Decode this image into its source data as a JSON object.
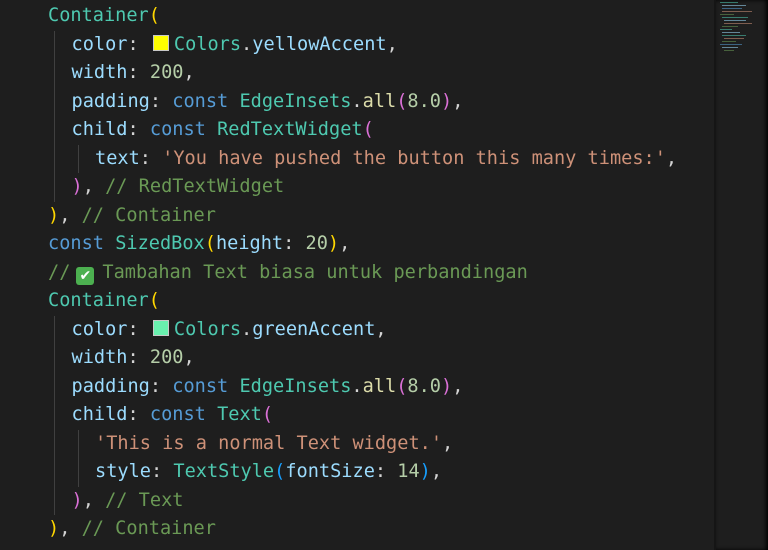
{
  "editor": {
    "lines": [
      {
        "indent": 0,
        "tokens": [
          {
            "t": "Container",
            "c": "cls"
          },
          {
            "t": "(",
            "c": "b1"
          }
        ]
      },
      {
        "indent": 1,
        "tokens": [
          {
            "t": "color",
            "c": "prop"
          },
          {
            "t": ": ",
            "c": "pun"
          },
          {
            "swatch": "#ffff00",
            "name": "yellow-accent-swatch"
          },
          {
            "t": "Colors",
            "c": "cls"
          },
          {
            "t": ".",
            "c": "pun"
          },
          {
            "t": "yellowAccent",
            "c": "prop"
          },
          {
            "t": ",",
            "c": "pun"
          }
        ]
      },
      {
        "indent": 1,
        "tokens": [
          {
            "t": "width",
            "c": "prop"
          },
          {
            "t": ": ",
            "c": "pun"
          },
          {
            "t": "200",
            "c": "num"
          },
          {
            "t": ",",
            "c": "pun"
          }
        ]
      },
      {
        "indent": 1,
        "tokens": [
          {
            "t": "padding",
            "c": "prop"
          },
          {
            "t": ": ",
            "c": "pun"
          },
          {
            "t": "const",
            "c": "kw"
          },
          {
            "t": " ",
            "c": "pun"
          },
          {
            "t": "EdgeInsets",
            "c": "cls"
          },
          {
            "t": ".",
            "c": "pun"
          },
          {
            "t": "all",
            "c": "fn"
          },
          {
            "t": "(",
            "c": "b2"
          },
          {
            "t": "8.0",
            "c": "num"
          },
          {
            "t": ")",
            "c": "b2"
          },
          {
            "t": ",",
            "c": "pun"
          }
        ]
      },
      {
        "indent": 1,
        "tokens": [
          {
            "t": "child",
            "c": "prop"
          },
          {
            "t": ": ",
            "c": "pun"
          },
          {
            "t": "const",
            "c": "kw"
          },
          {
            "t": " ",
            "c": "pun"
          },
          {
            "t": "RedTextWidget",
            "c": "cls"
          },
          {
            "t": "(",
            "c": "b2"
          }
        ]
      },
      {
        "indent": 2,
        "tokens": [
          {
            "t": "text",
            "c": "prop"
          },
          {
            "t": ": ",
            "c": "pun"
          },
          {
            "t": "'You have pushed the button this many times:'",
            "c": "str"
          },
          {
            "t": ",",
            "c": "pun"
          }
        ]
      },
      {
        "indent": 1,
        "tokens": [
          {
            "t": ")",
            "c": "b2"
          },
          {
            "t": ", ",
            "c": "pun"
          },
          {
            "t": "// RedTextWidget",
            "c": "cmt"
          }
        ]
      },
      {
        "indent": 0,
        "tokens": [
          {
            "t": ")",
            "c": "b1"
          },
          {
            "t": ", ",
            "c": "pun"
          },
          {
            "t": "// Container",
            "c": "cmt"
          }
        ]
      },
      {
        "indent": 0,
        "tokens": [
          {
            "t": "const",
            "c": "kw"
          },
          {
            "t": " ",
            "c": "pun"
          },
          {
            "t": "SizedBox",
            "c": "cls"
          },
          {
            "t": "(",
            "c": "b1"
          },
          {
            "t": "height",
            "c": "prop"
          },
          {
            "t": ": ",
            "c": "pun"
          },
          {
            "t": "20",
            "c": "num"
          },
          {
            "t": ")",
            "c": "b1"
          },
          {
            "t": ",",
            "c": "pun"
          }
        ]
      },
      {
        "indent": 0,
        "tokens": [
          {
            "t": "//",
            "c": "cmt"
          },
          {
            "check": true,
            "name": "check-mark-emoji-icon"
          },
          {
            "t": "Tambahan Text biasa untuk perbandingan",
            "c": "cmt"
          }
        ]
      },
      {
        "indent": 0,
        "tokens": [
          {
            "t": "Container",
            "c": "cls"
          },
          {
            "t": "(",
            "c": "b1"
          }
        ]
      },
      {
        "indent": 1,
        "tokens": [
          {
            "t": "color",
            "c": "prop"
          },
          {
            "t": ": ",
            "c": "pun"
          },
          {
            "swatch": "#69f0ae",
            "name": "green-accent-swatch"
          },
          {
            "t": "Colors",
            "c": "cls"
          },
          {
            "t": ".",
            "c": "pun"
          },
          {
            "t": "greenAccent",
            "c": "prop"
          },
          {
            "t": ",",
            "c": "pun"
          }
        ]
      },
      {
        "indent": 1,
        "tokens": [
          {
            "t": "width",
            "c": "prop"
          },
          {
            "t": ": ",
            "c": "pun"
          },
          {
            "t": "200",
            "c": "num"
          },
          {
            "t": ",",
            "c": "pun"
          }
        ]
      },
      {
        "indent": 1,
        "tokens": [
          {
            "t": "padding",
            "c": "prop"
          },
          {
            "t": ": ",
            "c": "pun"
          },
          {
            "t": "const",
            "c": "kw"
          },
          {
            "t": " ",
            "c": "pun"
          },
          {
            "t": "EdgeInsets",
            "c": "cls"
          },
          {
            "t": ".",
            "c": "pun"
          },
          {
            "t": "all",
            "c": "fn"
          },
          {
            "t": "(",
            "c": "b2"
          },
          {
            "t": "8.0",
            "c": "num"
          },
          {
            "t": ")",
            "c": "b2"
          },
          {
            "t": ",",
            "c": "pun"
          }
        ]
      },
      {
        "indent": 1,
        "tokens": [
          {
            "t": "child",
            "c": "prop"
          },
          {
            "t": ": ",
            "c": "pun"
          },
          {
            "t": "const",
            "c": "kw"
          },
          {
            "t": " ",
            "c": "pun"
          },
          {
            "t": "Text",
            "c": "cls"
          },
          {
            "t": "(",
            "c": "b2"
          }
        ]
      },
      {
        "indent": 2,
        "tokens": [
          {
            "t": "'This is a normal Text widget.'",
            "c": "str"
          },
          {
            "t": ",",
            "c": "pun"
          }
        ]
      },
      {
        "indent": 2,
        "tokens": [
          {
            "t": "style",
            "c": "prop"
          },
          {
            "t": ": ",
            "c": "pun"
          },
          {
            "t": "TextStyle",
            "c": "cls"
          },
          {
            "t": "(",
            "c": "b3"
          },
          {
            "t": "fontSize",
            "c": "prop"
          },
          {
            "t": ": ",
            "c": "pun"
          },
          {
            "t": "14",
            "c": "num"
          },
          {
            "t": ")",
            "c": "b3"
          },
          {
            "t": ",",
            "c": "pun"
          }
        ]
      },
      {
        "indent": 1,
        "tokens": [
          {
            "t": ")",
            "c": "b2"
          },
          {
            "t": ", ",
            "c": "pun"
          },
          {
            "t": "// Text",
            "c": "cmt"
          }
        ]
      },
      {
        "indent": 0,
        "tokens": [
          {
            "t": ")",
            "c": "b1"
          },
          {
            "t": ", ",
            "c": "pun"
          },
          {
            "t": "// Container",
            "c": "cmt"
          }
        ]
      }
    ]
  },
  "colors": {
    "background": "#1e1e1e",
    "type": "#4ec9b0",
    "property": "#9cdcfe",
    "keyword": "#569cd6",
    "string": "#ce9178",
    "number": "#b5cea8",
    "function": "#dcdcaa",
    "comment": "#6a9955",
    "bracket_level1": "#ffd700",
    "bracket_level2": "#da70d6",
    "bracket_level3": "#179fff"
  }
}
